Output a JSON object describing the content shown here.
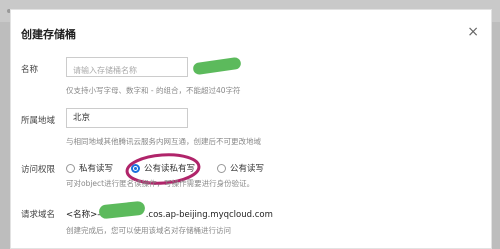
{
  "dialog": {
    "title": "创建存储桶",
    "close_glyph": "×"
  },
  "fields": {
    "name": {
      "label": "名称",
      "placeholder": "请输入存储桶名称",
      "hint": "仅支持小写字母、数字和 - 的组合，不能超过40字符"
    },
    "region": {
      "label": "所属地域",
      "value": "北京",
      "hint": "与相同地域其他腾讯云服务内网互通，创建后不可更改地域"
    },
    "access": {
      "label": "访问权限",
      "options": [
        {
          "label": "私有读写",
          "selected": false
        },
        {
          "label": "公有读私有写",
          "selected": true
        },
        {
          "label": "公有读写",
          "selected": false
        }
      ],
      "hint": "可对object进行匿名读操作，写操作需要进行身份验证。"
    },
    "domain": {
      "label": "请求域名",
      "prefix": "<名称>-",
      "suffix": ".cos.ap-beijing.myqcloud.com",
      "hint": "创建完成后，您可以使用该域名对存储桶进行访问"
    }
  },
  "colors": {
    "accent": "#1a6fdd",
    "annotation_circle": "#b0246a",
    "redaction_scribble": "#3fae3f"
  }
}
